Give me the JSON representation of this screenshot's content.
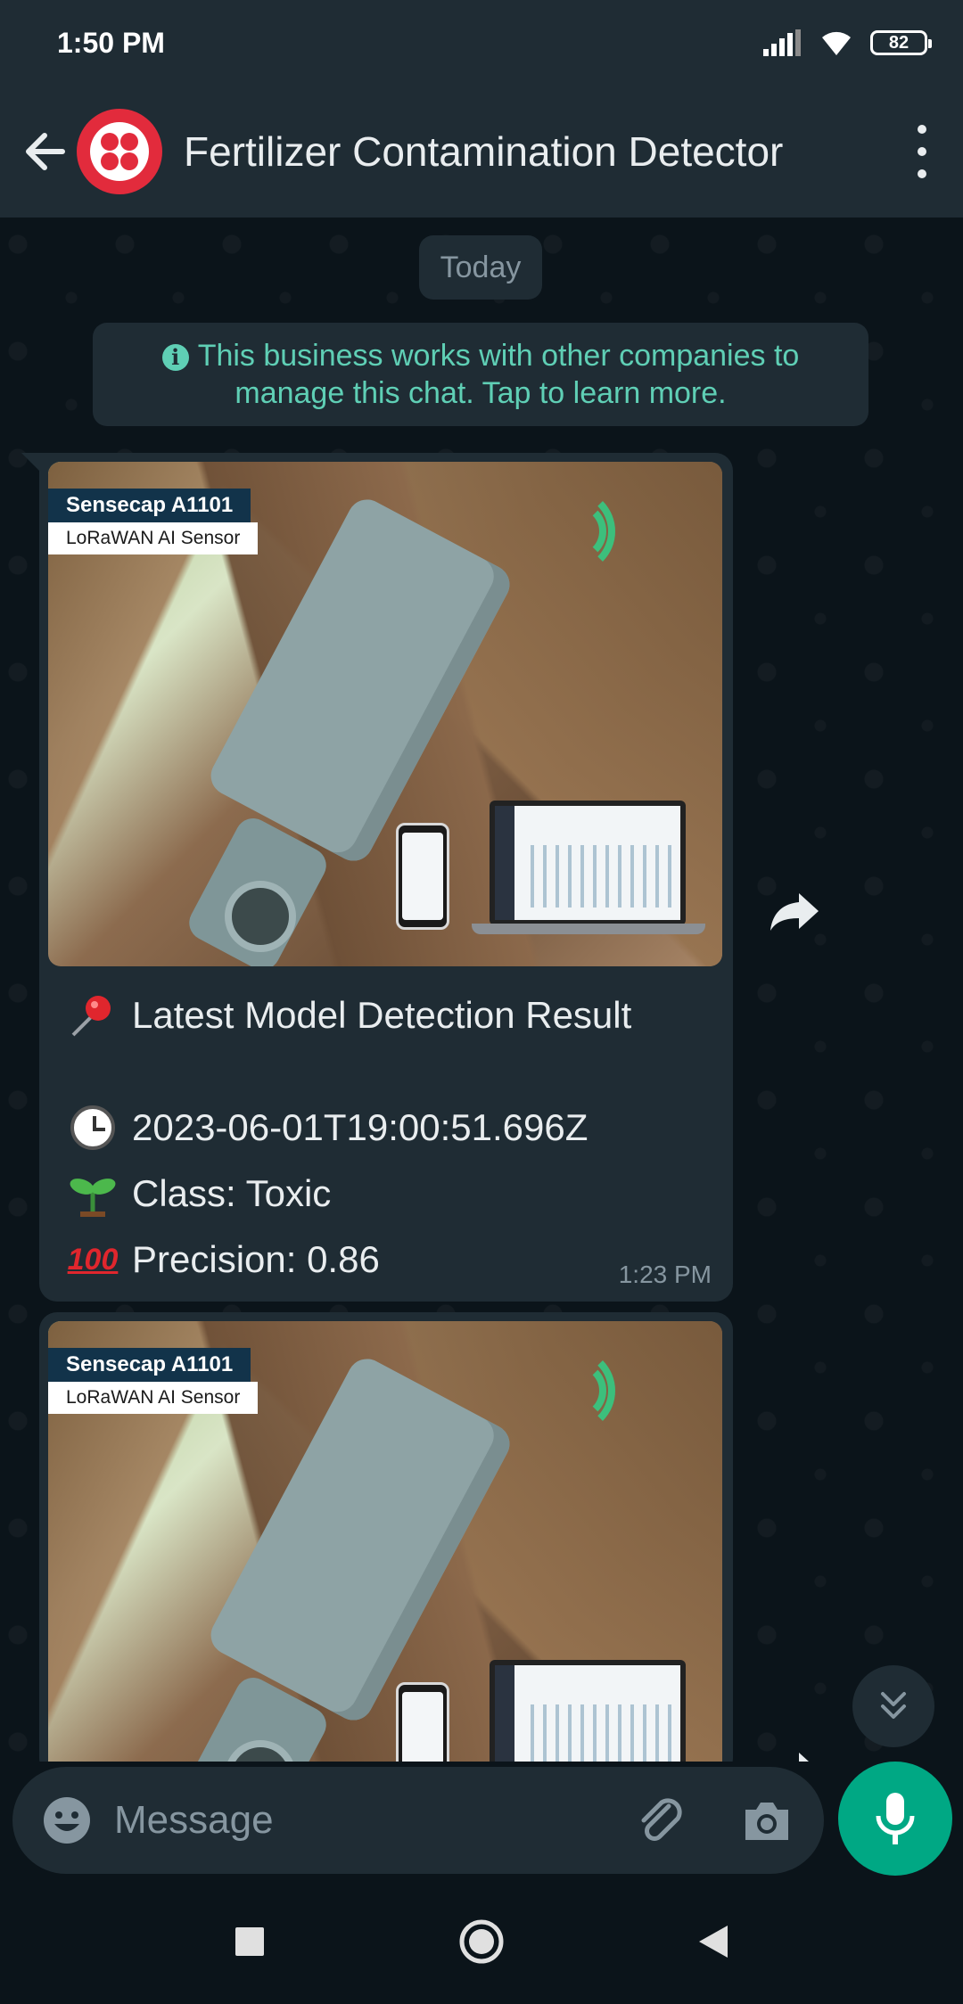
{
  "status_bar": {
    "time": "1:50 PM",
    "battery": "82"
  },
  "header": {
    "title": "Fertilizer Contamination Detector"
  },
  "chat": {
    "date_chip": "Today",
    "info_notice": "This business works with other companies to manage this chat. Tap to learn more.",
    "messages": [
      {
        "image": {
          "brand_title": "Sensecap A1101",
          "brand_subtitle": "LoRaWAN AI Sensor"
        },
        "heading": "Latest Model Detection Result",
        "timestamp_line": "2023-06-01T19:00:51.696Z",
        "class_line": "Class: Toxic",
        "precision_line": "Precision: 0.86",
        "hundred_emoji": "100",
        "time": "1:23 PM"
      },
      {
        "image": {
          "brand_title": "Sensecap A1101",
          "brand_subtitle": "LoRaWAN AI Sensor"
        }
      }
    ]
  },
  "composer": {
    "placeholder": "Message"
  },
  "colors": {
    "accent": "#00a884",
    "header_bg": "#1f2c34",
    "chat_bg": "#0b141a",
    "bubble_bg": "#1f2c34",
    "info_text": "#5fcfb5"
  },
  "icons": {
    "back": "arrow-left-icon",
    "menu": "more-vert-icon",
    "forward": "forward-icon",
    "scroll": "double-chevron-down-icon",
    "emoji": "emoji-icon",
    "attach": "paperclip-icon",
    "camera": "camera-icon",
    "mic": "mic-icon",
    "nav_recent": "square-icon",
    "nav_home": "circle-icon",
    "nav_back": "triangle-icon"
  }
}
